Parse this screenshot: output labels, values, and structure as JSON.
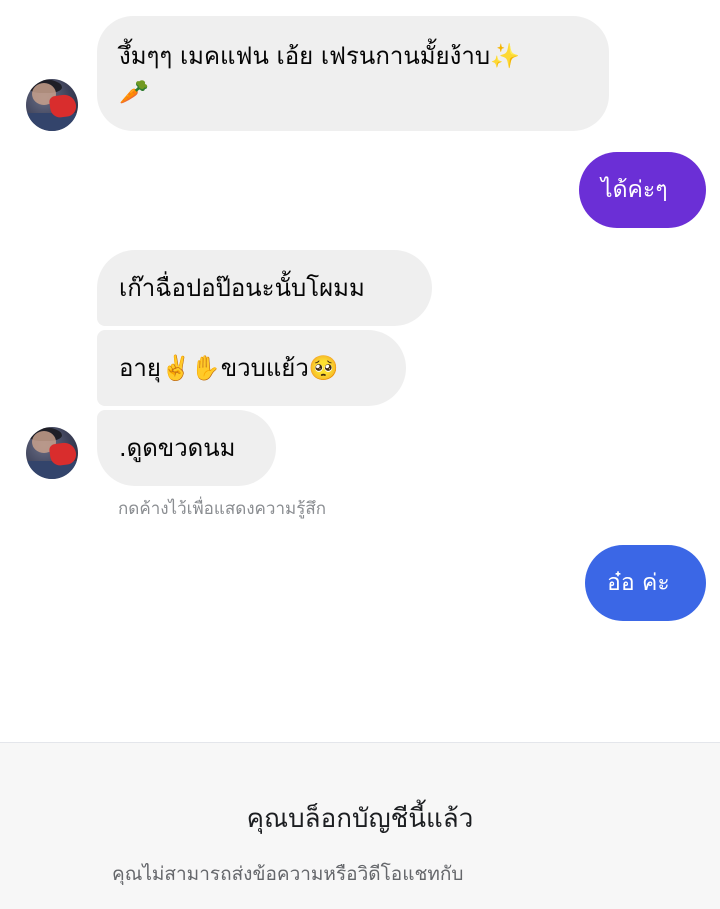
{
  "chat": {
    "messages": [
      {
        "from": "them",
        "text": "งึ้มๆๆ เมคแฟน เอ้ย เฟรนกานมั้ยง้าบ✨",
        "text_line2": "🥕"
      },
      {
        "from": "me",
        "text": "ได้ค่ะๆ"
      },
      {
        "from": "them",
        "text": "เก๊าฉื่อปอป๊อนะนั้บโผมม"
      },
      {
        "from": "them",
        "text": "อายุ✌️✋ขวบแย้ว🥺"
      },
      {
        "from": "them",
        "text": ".ดูดขวดนม"
      },
      {
        "from": "me",
        "text": "อ๋อ ค่ะ"
      }
    ],
    "hint": "กดค้างไว้เพื่อแสดงความรู้สึก"
  },
  "colors": {
    "incoming_bubble": "#efefef",
    "outgoing_purple": "#6b2fd6",
    "outgoing_blue": "#3b67e6"
  },
  "blocked_banner": {
    "title": "คุณบล็อกบัญชีนี้แล้ว",
    "subtitle": "คุณไม่สามารถส่งข้อความหรือวิดีโอแชทกับ"
  }
}
